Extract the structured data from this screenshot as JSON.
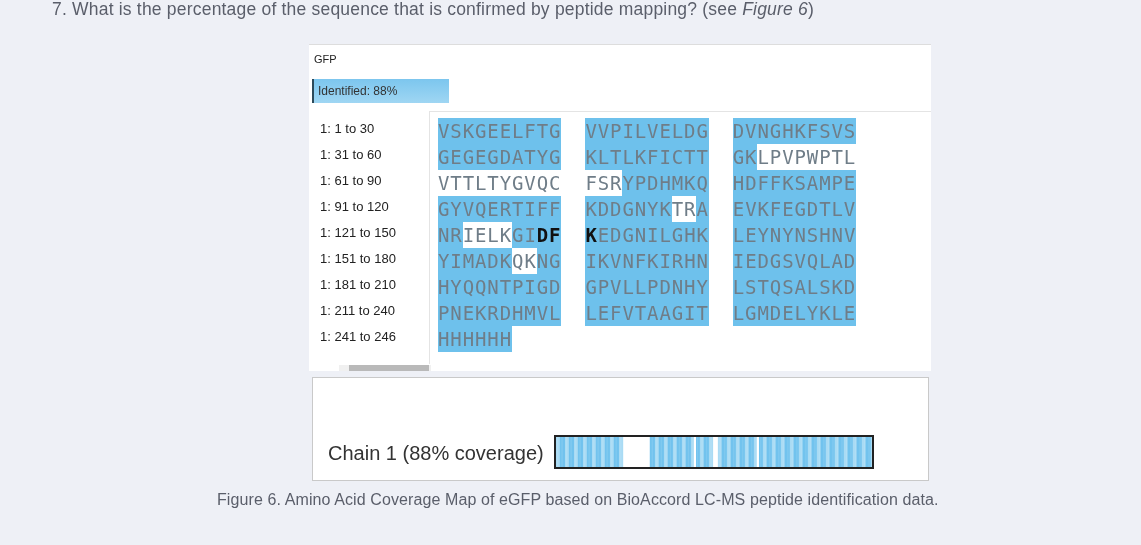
{
  "question": "7. What is the percentage of the sequence that is confirmed by peptide mapping? (see *Figure 6*)",
  "figure": {
    "protein": "GFP",
    "identified": {
      "label": "Identified: 88%",
      "selected": true
    },
    "rows": [
      {
        "range": "1: 1 to 30",
        "blocks": [
          [
            {
              "text": "VSKGEELFTG",
              "covered": true
            }
          ],
          [
            {
              "text": "VVPILVELDG",
              "covered": true
            }
          ],
          [
            {
              "text": "DVNGHKFSVS",
              "covered": true
            }
          ]
        ]
      },
      {
        "range": "1: 31 to 60",
        "blocks": [
          [
            {
              "text": "GEGEGDATYG",
              "covered": true
            }
          ],
          [
            {
              "text": "KLTLKFICTT",
              "covered": true
            }
          ],
          [
            {
              "text": "GK",
              "covered": true
            },
            {
              "text": "LPVPWPTL",
              "covered": false
            }
          ]
        ]
      },
      {
        "range": "1: 61 to 90",
        "blocks": [
          [
            {
              "text": "VTTLTYGVQC",
              "covered": false
            }
          ],
          [
            {
              "text": "FSR",
              "covered": false
            },
            {
              "text": "YPDHMKQ",
              "covered": true
            }
          ],
          [
            {
              "text": "HDFFKSAMPE",
              "covered": true
            }
          ]
        ]
      },
      {
        "range": "1: 91 to 120",
        "blocks": [
          [
            {
              "text": "GYVQERTIFF",
              "covered": true
            }
          ],
          [
            {
              "text": "KDDGNYK",
              "covered": true
            },
            {
              "text": "TR",
              "covered": false
            },
            {
              "text": "A",
              "covered": true
            }
          ],
          [
            {
              "text": "EVKFEGDTLV",
              "covered": true
            }
          ]
        ]
      },
      {
        "range": "1: 121 to 150",
        "blocks": [
          [
            {
              "text": "NR",
              "covered": true
            },
            {
              "text": "IELK",
              "covered": false
            },
            {
              "text": "GI",
              "covered": true
            },
            {
              "text": "DF",
              "covered": true,
              "bold": true
            }
          ],
          [
            {
              "text": "K",
              "covered": true,
              "bold": true
            },
            {
              "text": "EDGNILGHK",
              "covered": true
            }
          ],
          [
            {
              "text": "LEYNYNSHNV",
              "covered": true
            }
          ]
        ]
      },
      {
        "range": "1: 151 to 180",
        "blocks": [
          [
            {
              "text": "YIMADK",
              "covered": true
            },
            {
              "text": "QK",
              "covered": false
            },
            {
              "text": "NG",
              "covered": true
            }
          ],
          [
            {
              "text": "IKVNFKIRHN",
              "covered": true
            }
          ],
          [
            {
              "text": "IEDGSVQLAD",
              "covered": true
            }
          ]
        ]
      },
      {
        "range": "1: 181 to 210",
        "blocks": [
          [
            {
              "text": "HYQQNTPIGD",
              "covered": true
            }
          ],
          [
            {
              "text": "GPVLLPDNHY",
              "covered": true
            }
          ],
          [
            {
              "text": "LSTQSALSKD",
              "covered": true
            }
          ]
        ]
      },
      {
        "range": "1: 211 to 240",
        "blocks": [
          [
            {
              "text": "PNEKRDHMVL",
              "covered": true
            }
          ],
          [
            {
              "text": "LEFVTAAGIT",
              "covered": true
            }
          ],
          [
            {
              "text": "LGMDELYKLE",
              "covered": true
            }
          ]
        ]
      },
      {
        "range": "1: 241 to 246",
        "blocks": [
          [
            {
              "text": "HHHHHH",
              "covered": true
            }
          ]
        ]
      }
    ],
    "chain_label": "Chain  1 (88% coverage)",
    "caption": "Figure 6. Amino Acid Coverage Map of eGFP based on BioAccord LC-MS peptide identification data."
  }
}
